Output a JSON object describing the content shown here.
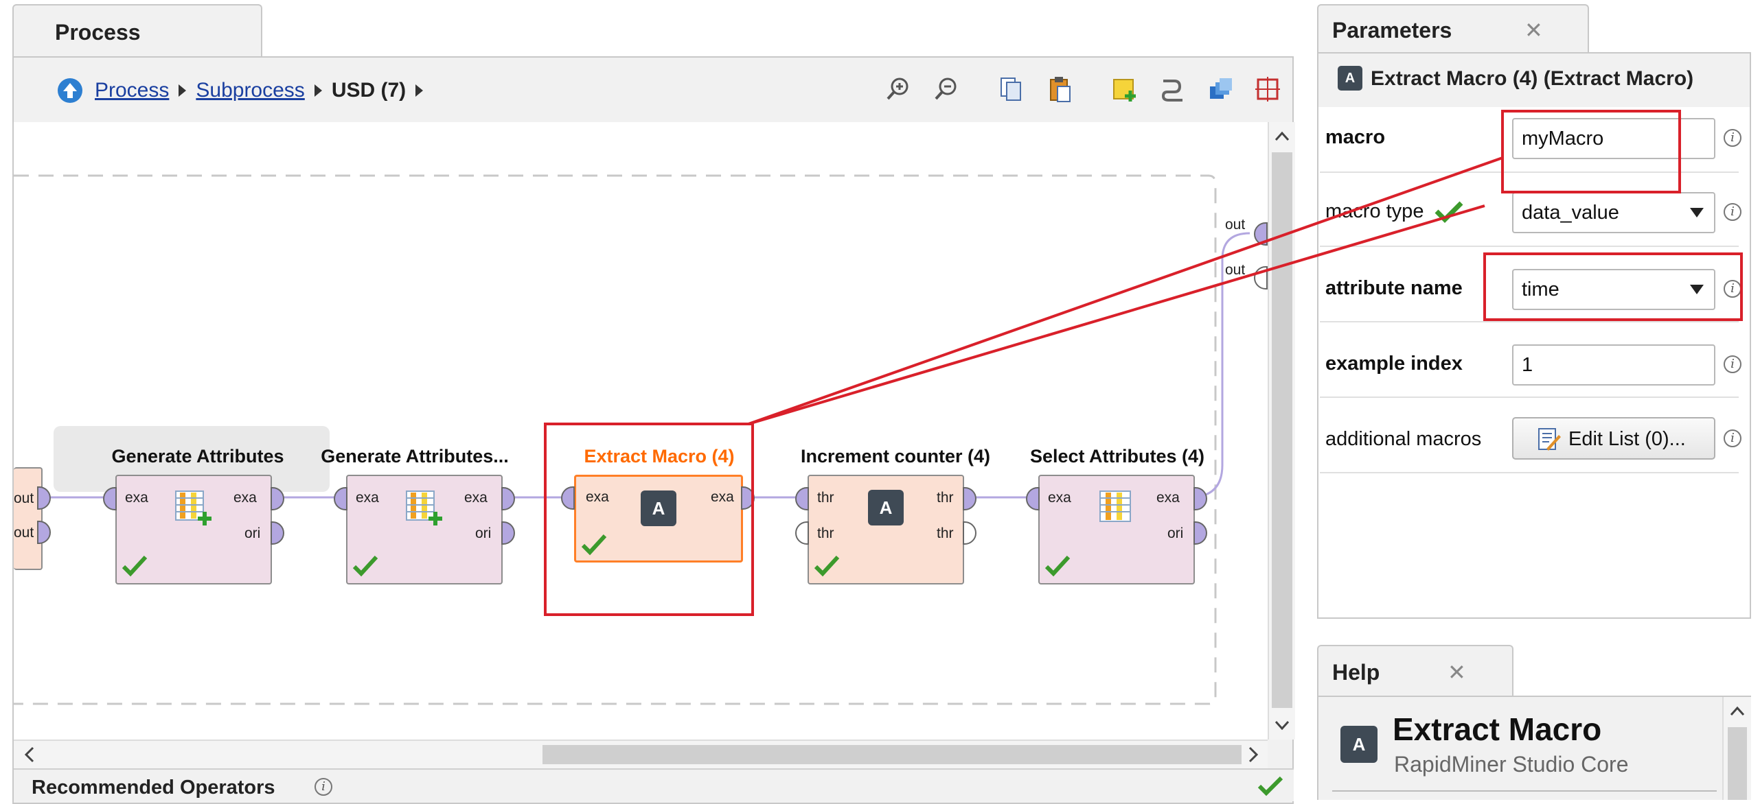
{
  "process": {
    "tab_label": "Process",
    "breadcrumb": {
      "items": [
        "Process",
        "Subprocess"
      ],
      "current": "USD (7)"
    },
    "operators": [
      {
        "title": "Generate Attributes",
        "in": [
          "exa"
        ],
        "out": [
          "exa",
          "ori"
        ]
      },
      {
        "title": "Generate Attributes...",
        "in": [
          "exa"
        ],
        "out": [
          "exa",
          "ori"
        ]
      },
      {
        "title": "Extract Macro (4)",
        "in": [
          "exa"
        ],
        "out": [
          "exa"
        ],
        "icon": "A"
      },
      {
        "title": "Increment counter (4)",
        "in": [
          "thr",
          "thr"
        ],
        "out": [
          "thr",
          "thr"
        ],
        "icon": "A"
      },
      {
        "title": "Select Attributes (4)",
        "in": [
          "exa"
        ],
        "out": [
          "exa",
          "ori"
        ]
      }
    ],
    "left_ports": [
      "out",
      "out"
    ],
    "right_ports": [
      "out",
      "out"
    ],
    "colors": {
      "selected_title": "#ff6a00",
      "selected_border": "#ff7f27",
      "subprocess_fill": "#f0dde8",
      "macro_fill": "#fbe0d3",
      "connection": "#b3a7e0"
    }
  },
  "recommended": {
    "label": "Recommended Operators"
  },
  "parameters": {
    "tab_label": "Parameters",
    "close_glyph": "✕",
    "operator_title": "Extract Macro (4) (Extract Macro)",
    "operator_icon": "A",
    "rows": [
      {
        "label": "macro",
        "value": "myMacro",
        "kind": "text"
      },
      {
        "label": "macro type",
        "value": "data_value",
        "kind": "select"
      },
      {
        "label": "attribute name",
        "value": "time",
        "kind": "select"
      },
      {
        "label": "example index",
        "value": "1",
        "kind": "text"
      },
      {
        "label": "additional macros",
        "value": "Edit List (0)...",
        "kind": "button"
      }
    ]
  },
  "help": {
    "tab_label": "Help",
    "close_glyph": "✕",
    "title": "Extract Macro",
    "subtitle": "RapidMiner Studio Core",
    "icon": "A"
  }
}
